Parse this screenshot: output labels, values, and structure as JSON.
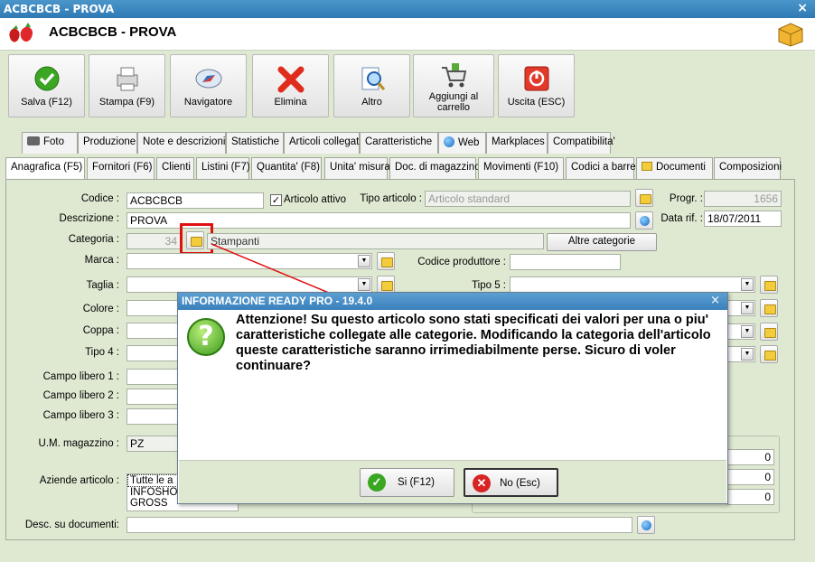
{
  "window": {
    "title": "ACBCBCB - PROVA",
    "close": "×"
  },
  "header": {
    "name": "ACBCBCB - PROVA"
  },
  "toolbar": [
    {
      "label": "Salva (F12)",
      "icon": "check-icon"
    },
    {
      "label": "Stampa (F9)",
      "icon": "printer-icon"
    },
    {
      "label": "Navigatore",
      "icon": "compass-icon"
    },
    {
      "label": "Elimina",
      "icon": "delete-x-icon"
    },
    {
      "label": "Altro",
      "icon": "search-doc-icon"
    },
    {
      "label": "Aggiungi al carrello",
      "icon": "cart-icon"
    },
    {
      "label": "Uscita (ESC)",
      "icon": "power-icon"
    }
  ],
  "tabs_top": [
    "Foto",
    "Produzione",
    "Note e descrizioni",
    "Statistiche",
    "Articoli collegati",
    "Caratteristiche",
    "Web",
    "Markplaces",
    "Compatibilita'"
  ],
  "tabs_bottom": [
    "Anagrafica (F5)",
    "Fornitori (F6)",
    "Clienti",
    "Listini (F7)",
    "Quantita' (F8)",
    "Unita' misura",
    "Doc. di magazzino",
    "Movimenti (F10)",
    "Codici a barre",
    "Documenti",
    "Composizioni"
  ],
  "form": {
    "codice_label": "Codice :",
    "codice": "ACBCBCB",
    "attivo_label": "Articolo attivo",
    "tipo_label": "Tipo articolo :",
    "tipo_placeholder": "Articolo standard",
    "progr_label": "Progr. :",
    "progr": "1656",
    "descrizione_label": "Descrizione :",
    "descrizione": "PROVA",
    "data_label": "Data rif. :",
    "data": "18/07/2011",
    "categoria_label": "Categoria :",
    "categoria_code": "34",
    "categoria_name": "Stampanti",
    "altre_categorie": "Altre categorie",
    "marca_label": "Marca :",
    "codice_produttore_label": "Codice produttore :",
    "taglia_label": "Taglia :",
    "tipo5_label": "Tipo 5 :",
    "colore_label": "Colore :",
    "coppa_label": "Coppa :",
    "tipo4_label": "Tipo 4 :",
    "campo1_label": "Campo libero 1 :",
    "campo2_label": "Campo libero 2 :",
    "campo3_label": "Campo libero 3 :",
    "um_label": "U.M. magazzino :",
    "um": "PZ",
    "aziende_label": "Aziende articolo :",
    "aziende": [
      "Tutte le a",
      "INFOSHO",
      "GROSS"
    ],
    "desc_doc_label": "Desc. su documenti:",
    "zeros": [
      "0",
      "0",
      "0"
    ]
  },
  "dialog": {
    "title": "INFORMAZIONE READY PRO - 19.4.0",
    "close": "×",
    "message": "Attenzione! Su questo articolo sono stati specificati dei valori per una o piu' caratteristiche collegate alle categorie. Modificando la categoria dell'articolo queste caratteristiche saranno irrimediabilmente perse. Sicuro di voler continuare?",
    "yes": "Si (F12)",
    "no": "No (Esc)"
  }
}
